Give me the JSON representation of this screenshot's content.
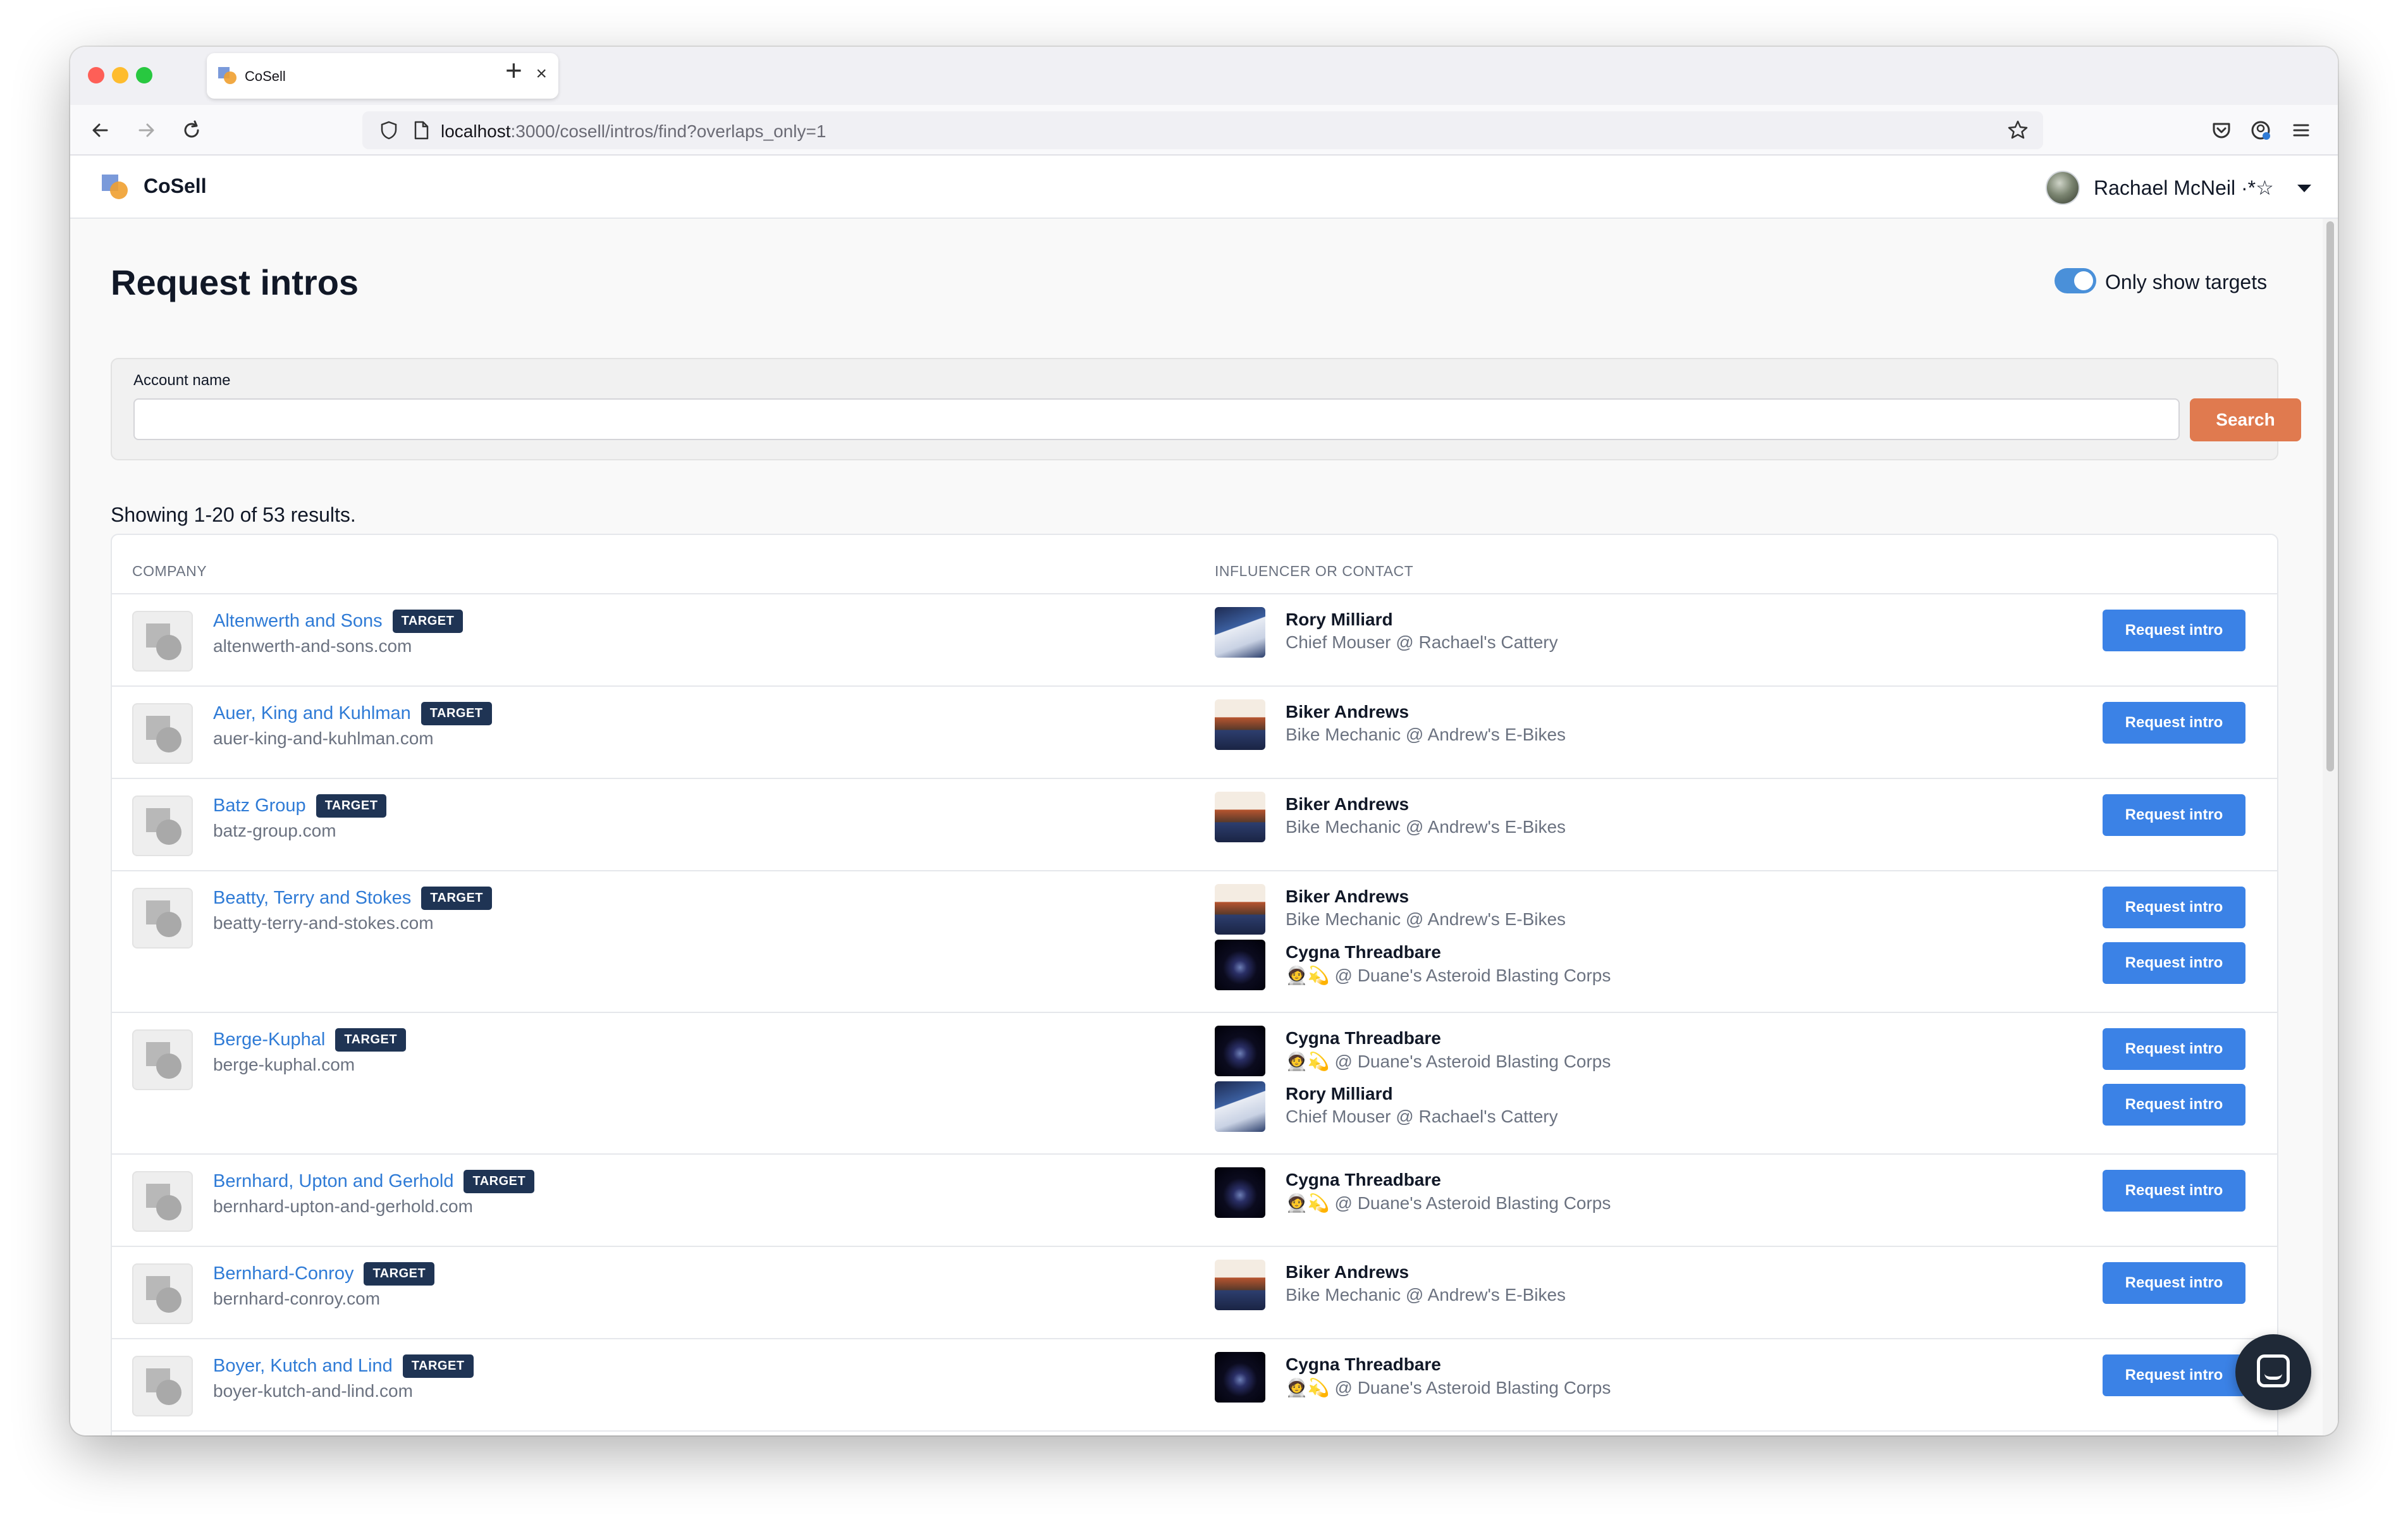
{
  "browser": {
    "tab_title": "CoSell",
    "url_host": "localhost",
    "url_path": ":3000/cosell/intros/find?overlaps_only=1"
  },
  "app": {
    "brand": "CoSell",
    "user_name": "Rachael McNeil ·*☆"
  },
  "page": {
    "title": "Request intros",
    "toggle_label": "Only show targets",
    "toggle_on": true,
    "search": {
      "label": "Account name",
      "value": "",
      "placeholder": "",
      "button": "Search"
    },
    "results_count": "Showing 1-20 of 53 results."
  },
  "table": {
    "col_company": "COMPANY",
    "col_contact": "INFLUENCER OR CONTACT",
    "badge": "TARGET",
    "request_label": "Request intro",
    "rows": [
      {
        "name": "Altenwerth and Sons",
        "domain": "altenwerth-and-sons.com",
        "contacts": [
          {
            "name": "Rory Milliard",
            "title": "Chief Mouser @ Rachael's Cattery",
            "img": "cat"
          }
        ]
      },
      {
        "name": "Auer, King and Kuhlman",
        "domain": "auer-king-and-kuhlman.com",
        "contacts": [
          {
            "name": "Biker Andrews",
            "title": "Bike Mechanic @ Andrew's E-Bikes",
            "img": "biker"
          }
        ]
      },
      {
        "name": "Batz Group",
        "domain": "batz-group.com",
        "contacts": [
          {
            "name": "Biker Andrews",
            "title": "Bike Mechanic @ Andrew's E-Bikes",
            "img": "biker"
          }
        ]
      },
      {
        "name": "Beatty, Terry and Stokes",
        "domain": "beatty-terry-and-stokes.com",
        "contacts": [
          {
            "name": "Biker Andrews",
            "title": "Bike Mechanic @ Andrew's E-Bikes",
            "img": "biker"
          },
          {
            "name": "Cygna Threadbare",
            "title": "🧑‍🚀💫 @ Duane's Asteroid Blasting Corps",
            "img": "space"
          }
        ]
      },
      {
        "name": "Berge-Kuphal",
        "domain": "berge-kuphal.com",
        "contacts": [
          {
            "name": "Cygna Threadbare",
            "title": "🧑‍🚀💫 @ Duane's Asteroid Blasting Corps",
            "img": "space"
          },
          {
            "name": "Rory Milliard",
            "title": "Chief Mouser @ Rachael's Cattery",
            "img": "cat"
          }
        ]
      },
      {
        "name": "Bernhard, Upton and Gerhold",
        "domain": "bernhard-upton-and-gerhold.com",
        "contacts": [
          {
            "name": "Cygna Threadbare",
            "title": "🧑‍🚀💫 @ Duane's Asteroid Blasting Corps",
            "img": "space"
          }
        ]
      },
      {
        "name": "Bernhard-Conroy",
        "domain": "bernhard-conroy.com",
        "contacts": [
          {
            "name": "Biker Andrews",
            "title": "Bike Mechanic @ Andrew's E-Bikes",
            "img": "biker"
          }
        ]
      },
      {
        "name": "Boyer, Kutch and Lind",
        "domain": "boyer-kutch-and-lind.com",
        "contacts": [
          {
            "name": "Cygna Threadbare",
            "title": "🧑‍🚀💫 @ Duane's Asteroid Blasting Corps",
            "img": "space"
          }
        ]
      }
    ]
  },
  "icons": {
    "back": "arrow-left-icon",
    "forward": "arrow-right-icon",
    "reload": "reload-icon",
    "shield": "shield-icon",
    "page": "page-icon",
    "bookmark": "star-icon",
    "pocket": "pocket-icon",
    "account": "account-icon",
    "menu": "hamburger-menu-icon",
    "chat": "chat-icon"
  },
  "colors": {
    "link": "#2f7bd6",
    "badge": "#1f3454",
    "search_button": "#e07a4f",
    "request_button": "#3b82e6",
    "toggle": "#4a90d9"
  }
}
